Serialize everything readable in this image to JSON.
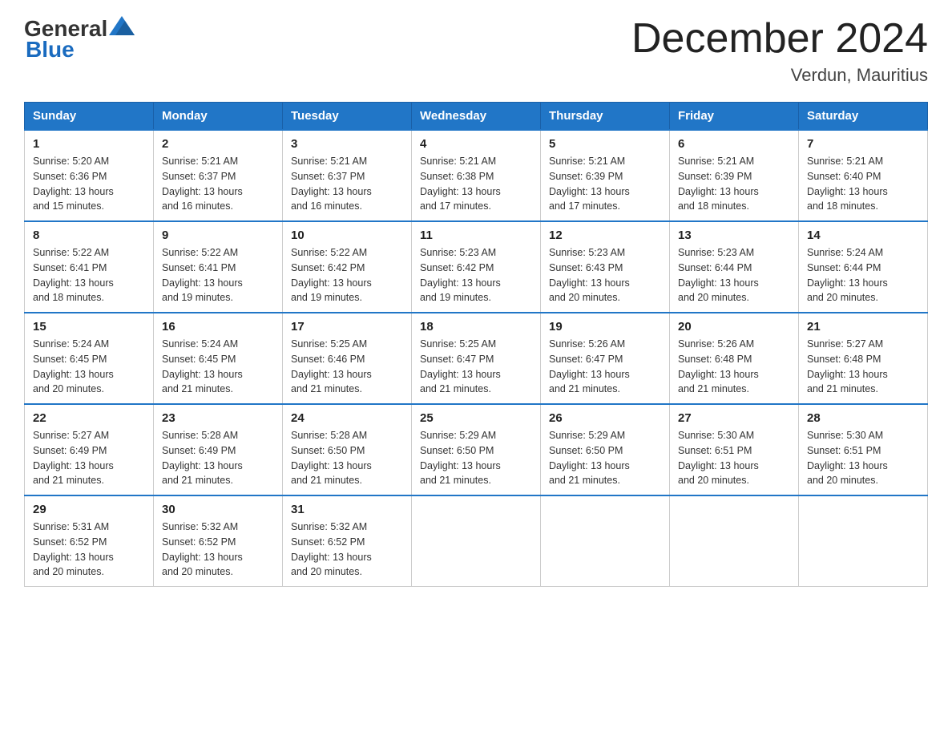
{
  "logo": {
    "general": "General",
    "blue": "Blue"
  },
  "title": "December 2024",
  "subtitle": "Verdun, Mauritius",
  "days_header": [
    "Sunday",
    "Monday",
    "Tuesday",
    "Wednesday",
    "Thursday",
    "Friday",
    "Saturday"
  ],
  "weeks": [
    [
      {
        "num": "1",
        "sunrise": "5:20 AM",
        "sunset": "6:36 PM",
        "daylight": "13 hours and 15 minutes."
      },
      {
        "num": "2",
        "sunrise": "5:21 AM",
        "sunset": "6:37 PM",
        "daylight": "13 hours and 16 minutes."
      },
      {
        "num": "3",
        "sunrise": "5:21 AM",
        "sunset": "6:37 PM",
        "daylight": "13 hours and 16 minutes."
      },
      {
        "num": "4",
        "sunrise": "5:21 AM",
        "sunset": "6:38 PM",
        "daylight": "13 hours and 17 minutes."
      },
      {
        "num": "5",
        "sunrise": "5:21 AM",
        "sunset": "6:39 PM",
        "daylight": "13 hours and 17 minutes."
      },
      {
        "num": "6",
        "sunrise": "5:21 AM",
        "sunset": "6:39 PM",
        "daylight": "13 hours and 18 minutes."
      },
      {
        "num": "7",
        "sunrise": "5:21 AM",
        "sunset": "6:40 PM",
        "daylight": "13 hours and 18 minutes."
      }
    ],
    [
      {
        "num": "8",
        "sunrise": "5:22 AM",
        "sunset": "6:41 PM",
        "daylight": "13 hours and 18 minutes."
      },
      {
        "num": "9",
        "sunrise": "5:22 AM",
        "sunset": "6:41 PM",
        "daylight": "13 hours and 19 minutes."
      },
      {
        "num": "10",
        "sunrise": "5:22 AM",
        "sunset": "6:42 PM",
        "daylight": "13 hours and 19 minutes."
      },
      {
        "num": "11",
        "sunrise": "5:23 AM",
        "sunset": "6:42 PM",
        "daylight": "13 hours and 19 minutes."
      },
      {
        "num": "12",
        "sunrise": "5:23 AM",
        "sunset": "6:43 PM",
        "daylight": "13 hours and 20 minutes."
      },
      {
        "num": "13",
        "sunrise": "5:23 AM",
        "sunset": "6:44 PM",
        "daylight": "13 hours and 20 minutes."
      },
      {
        "num": "14",
        "sunrise": "5:24 AM",
        "sunset": "6:44 PM",
        "daylight": "13 hours and 20 minutes."
      }
    ],
    [
      {
        "num": "15",
        "sunrise": "5:24 AM",
        "sunset": "6:45 PM",
        "daylight": "13 hours and 20 minutes."
      },
      {
        "num": "16",
        "sunrise": "5:24 AM",
        "sunset": "6:45 PM",
        "daylight": "13 hours and 21 minutes."
      },
      {
        "num": "17",
        "sunrise": "5:25 AM",
        "sunset": "6:46 PM",
        "daylight": "13 hours and 21 minutes."
      },
      {
        "num": "18",
        "sunrise": "5:25 AM",
        "sunset": "6:47 PM",
        "daylight": "13 hours and 21 minutes."
      },
      {
        "num": "19",
        "sunrise": "5:26 AM",
        "sunset": "6:47 PM",
        "daylight": "13 hours and 21 minutes."
      },
      {
        "num": "20",
        "sunrise": "5:26 AM",
        "sunset": "6:48 PM",
        "daylight": "13 hours and 21 minutes."
      },
      {
        "num": "21",
        "sunrise": "5:27 AM",
        "sunset": "6:48 PM",
        "daylight": "13 hours and 21 minutes."
      }
    ],
    [
      {
        "num": "22",
        "sunrise": "5:27 AM",
        "sunset": "6:49 PM",
        "daylight": "13 hours and 21 minutes."
      },
      {
        "num": "23",
        "sunrise": "5:28 AM",
        "sunset": "6:49 PM",
        "daylight": "13 hours and 21 minutes."
      },
      {
        "num": "24",
        "sunrise": "5:28 AM",
        "sunset": "6:50 PM",
        "daylight": "13 hours and 21 minutes."
      },
      {
        "num": "25",
        "sunrise": "5:29 AM",
        "sunset": "6:50 PM",
        "daylight": "13 hours and 21 minutes."
      },
      {
        "num": "26",
        "sunrise": "5:29 AM",
        "sunset": "6:50 PM",
        "daylight": "13 hours and 21 minutes."
      },
      {
        "num": "27",
        "sunrise": "5:30 AM",
        "sunset": "6:51 PM",
        "daylight": "13 hours and 20 minutes."
      },
      {
        "num": "28",
        "sunrise": "5:30 AM",
        "sunset": "6:51 PM",
        "daylight": "13 hours and 20 minutes."
      }
    ],
    [
      {
        "num": "29",
        "sunrise": "5:31 AM",
        "sunset": "6:52 PM",
        "daylight": "13 hours and 20 minutes."
      },
      {
        "num": "30",
        "sunrise": "5:32 AM",
        "sunset": "6:52 PM",
        "daylight": "13 hours and 20 minutes."
      },
      {
        "num": "31",
        "sunrise": "5:32 AM",
        "sunset": "6:52 PM",
        "daylight": "13 hours and 20 minutes."
      },
      null,
      null,
      null,
      null
    ]
  ],
  "labels": {
    "sunrise": "Sunrise:",
    "sunset": "Sunset:",
    "daylight": "Daylight:"
  }
}
